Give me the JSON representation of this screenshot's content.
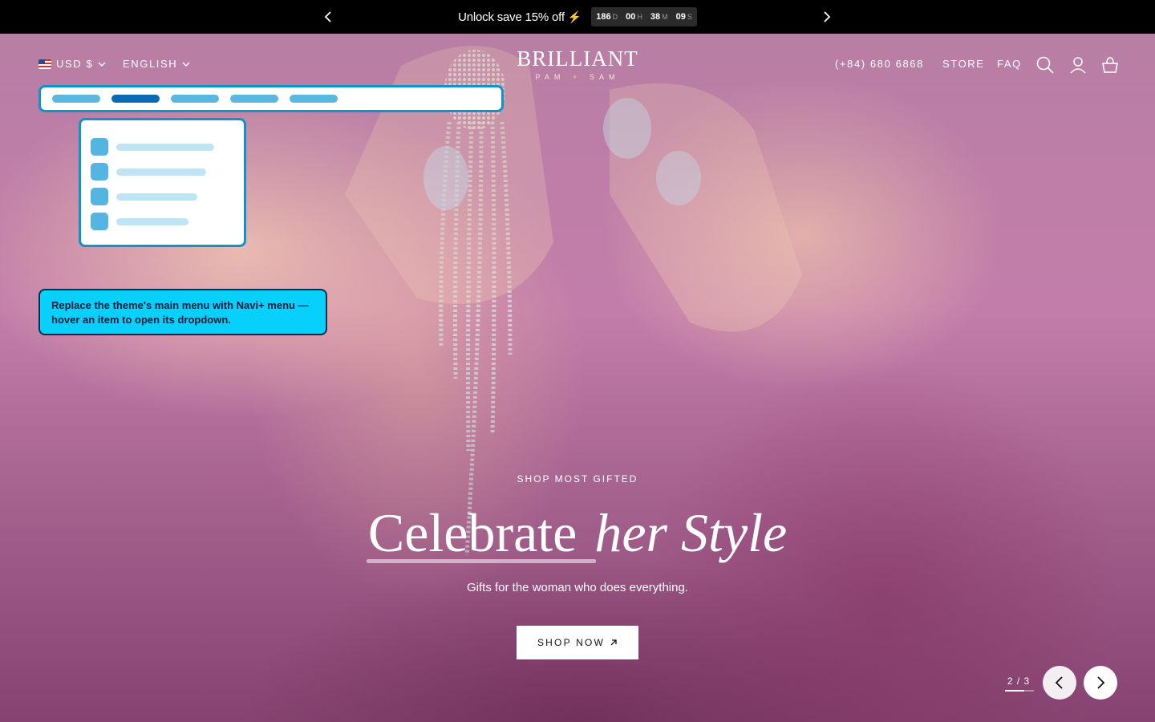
{
  "announcement": {
    "text": "Unlock save 15% off",
    "bolt": "⚡",
    "countdown": [
      {
        "value": "186",
        "unit": "D"
      },
      {
        "value": "00",
        "unit": "H"
      },
      {
        "value": "38",
        "unit": "M"
      },
      {
        "value": "09",
        "unit": "S"
      }
    ]
  },
  "header": {
    "currency": "USD $",
    "language": "ENGLISH",
    "logo_main": "BRILLIANT",
    "logo_sub_left": "PAM",
    "logo_sub_right": "SAM",
    "phone": "(+84) 680 6868",
    "store": "STORE",
    "faq": "FAQ",
    "icons": [
      "search-icon",
      "account-icon",
      "cart-icon"
    ]
  },
  "overlay": {
    "menu_items": 5,
    "active_index": 1,
    "tooltip": "Replace the theme's main menu with Navi+ menu — hover an item to open its dropdown."
  },
  "hero": {
    "eyebrow": "SHOP MOST GIFTED",
    "headline_regular": "Celebrate",
    "headline_italic": "her Style",
    "subtext": "Gifts for the woman who does everything.",
    "button": "SHOP NOW",
    "button_icon": "arrow-up-right-icon"
  },
  "slider": {
    "current": 2,
    "total": 3,
    "counter": "2 / 3"
  },
  "colors": {
    "announce_bg": "#000000",
    "overlay_accent": "#0f93cc",
    "tooltip_bg": "#06d0fb"
  }
}
